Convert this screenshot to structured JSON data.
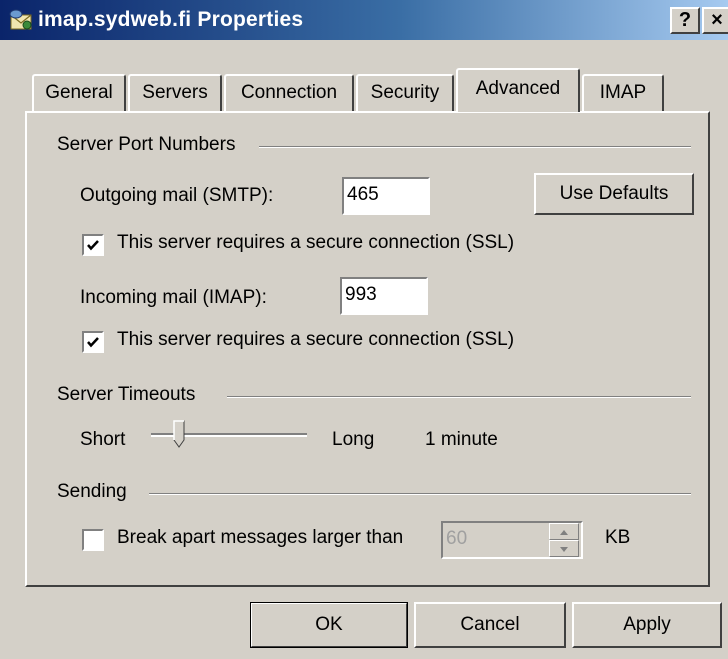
{
  "window": {
    "title": "imap.sydweb.fi Properties",
    "help_label": "?",
    "close_label": "×"
  },
  "tabs": [
    {
      "label": "General",
      "active": false
    },
    {
      "label": "Servers",
      "active": false
    },
    {
      "label": "Connection",
      "active": false
    },
    {
      "label": "Security",
      "active": false
    },
    {
      "label": "Advanced",
      "active": true
    },
    {
      "label": "IMAP",
      "active": false
    }
  ],
  "ports": {
    "group_title": "Server Port Numbers",
    "outgoing_label": "Outgoing mail (SMTP):",
    "outgoing_value": "465",
    "use_defaults_label": "Use Defaults",
    "outgoing_ssl_label": "This server requires a secure connection (SSL)",
    "outgoing_ssl_checked": true,
    "incoming_label": "Incoming mail (IMAP):",
    "incoming_value": "993",
    "incoming_ssl_label": "This server requires a secure connection (SSL)",
    "incoming_ssl_checked": true
  },
  "timeouts": {
    "group_title": "Server Timeouts",
    "short_label": "Short",
    "long_label": "Long",
    "value_label": "1 minute",
    "slider_fraction": 0.15
  },
  "sending": {
    "group_title": "Sending",
    "break_apart_label": "Break apart messages larger than",
    "break_apart_checked": false,
    "size_value": "60",
    "unit_label": "KB"
  },
  "buttons": {
    "ok": "OK",
    "cancel": "Cancel",
    "apply": "Apply"
  }
}
